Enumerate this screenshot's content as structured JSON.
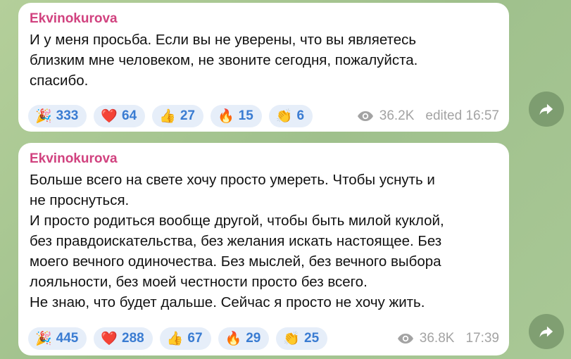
{
  "messages": [
    {
      "author": "Ekvinokurova",
      "text": "И у меня просьба. Если вы не уверены, что вы являетесь\nблизким мне человеком, не звоните сегодня, пожалуйста.\nспасибо.",
      "reactions": [
        {
          "emoji": "🎉",
          "emoji_name": "party-popper",
          "count": "333"
        },
        {
          "emoji": "❤️",
          "emoji_name": "red-heart",
          "count": "64"
        },
        {
          "emoji": "👍",
          "emoji_name": "thumbs-up",
          "count": "27"
        },
        {
          "emoji": "🔥",
          "emoji_name": "fire",
          "count": "15"
        },
        {
          "emoji": "👏",
          "emoji_name": "clapping-hands",
          "count": "6"
        }
      ],
      "views": "36.2K",
      "time": "edited 16:57"
    },
    {
      "author": "Ekvinokurova",
      "text": "Больше всего на свете хочу просто умереть. Чтобы уснуть и\nне проснуться.\nИ просто родиться вообще другой, чтобы быть милой куклой,\nбез правдоискательства, без желания искать настоящее. Без\nмоего вечного одиночества. Без мыслей, без вечного выбора\nлояльности, без моей честности просто без всего.\nНе знаю, что будет дальше. Сейчас я просто не хочу жить.",
      "reactions": [
        {
          "emoji": "🎉",
          "emoji_name": "party-popper",
          "count": "445"
        },
        {
          "emoji": "❤️",
          "emoji_name": "red-heart",
          "count": "288"
        },
        {
          "emoji": "👍",
          "emoji_name": "thumbs-up",
          "count": "67"
        },
        {
          "emoji": "🔥",
          "emoji_name": "fire",
          "count": "29"
        },
        {
          "emoji": "👏",
          "emoji_name": "clapping-hands",
          "count": "25"
        }
      ],
      "views": "36.8K",
      "time": "17:39"
    }
  ],
  "icons": {
    "views": "eye-icon",
    "forward": "forward-arrow-icon"
  },
  "colors": {
    "author": "#d1427f",
    "reaction_bg": "#e6eef9",
    "reaction_count": "#3a7cd2",
    "meta": "#a3a3a3",
    "bubble": "#ffffff",
    "background": "#a8c795"
  }
}
